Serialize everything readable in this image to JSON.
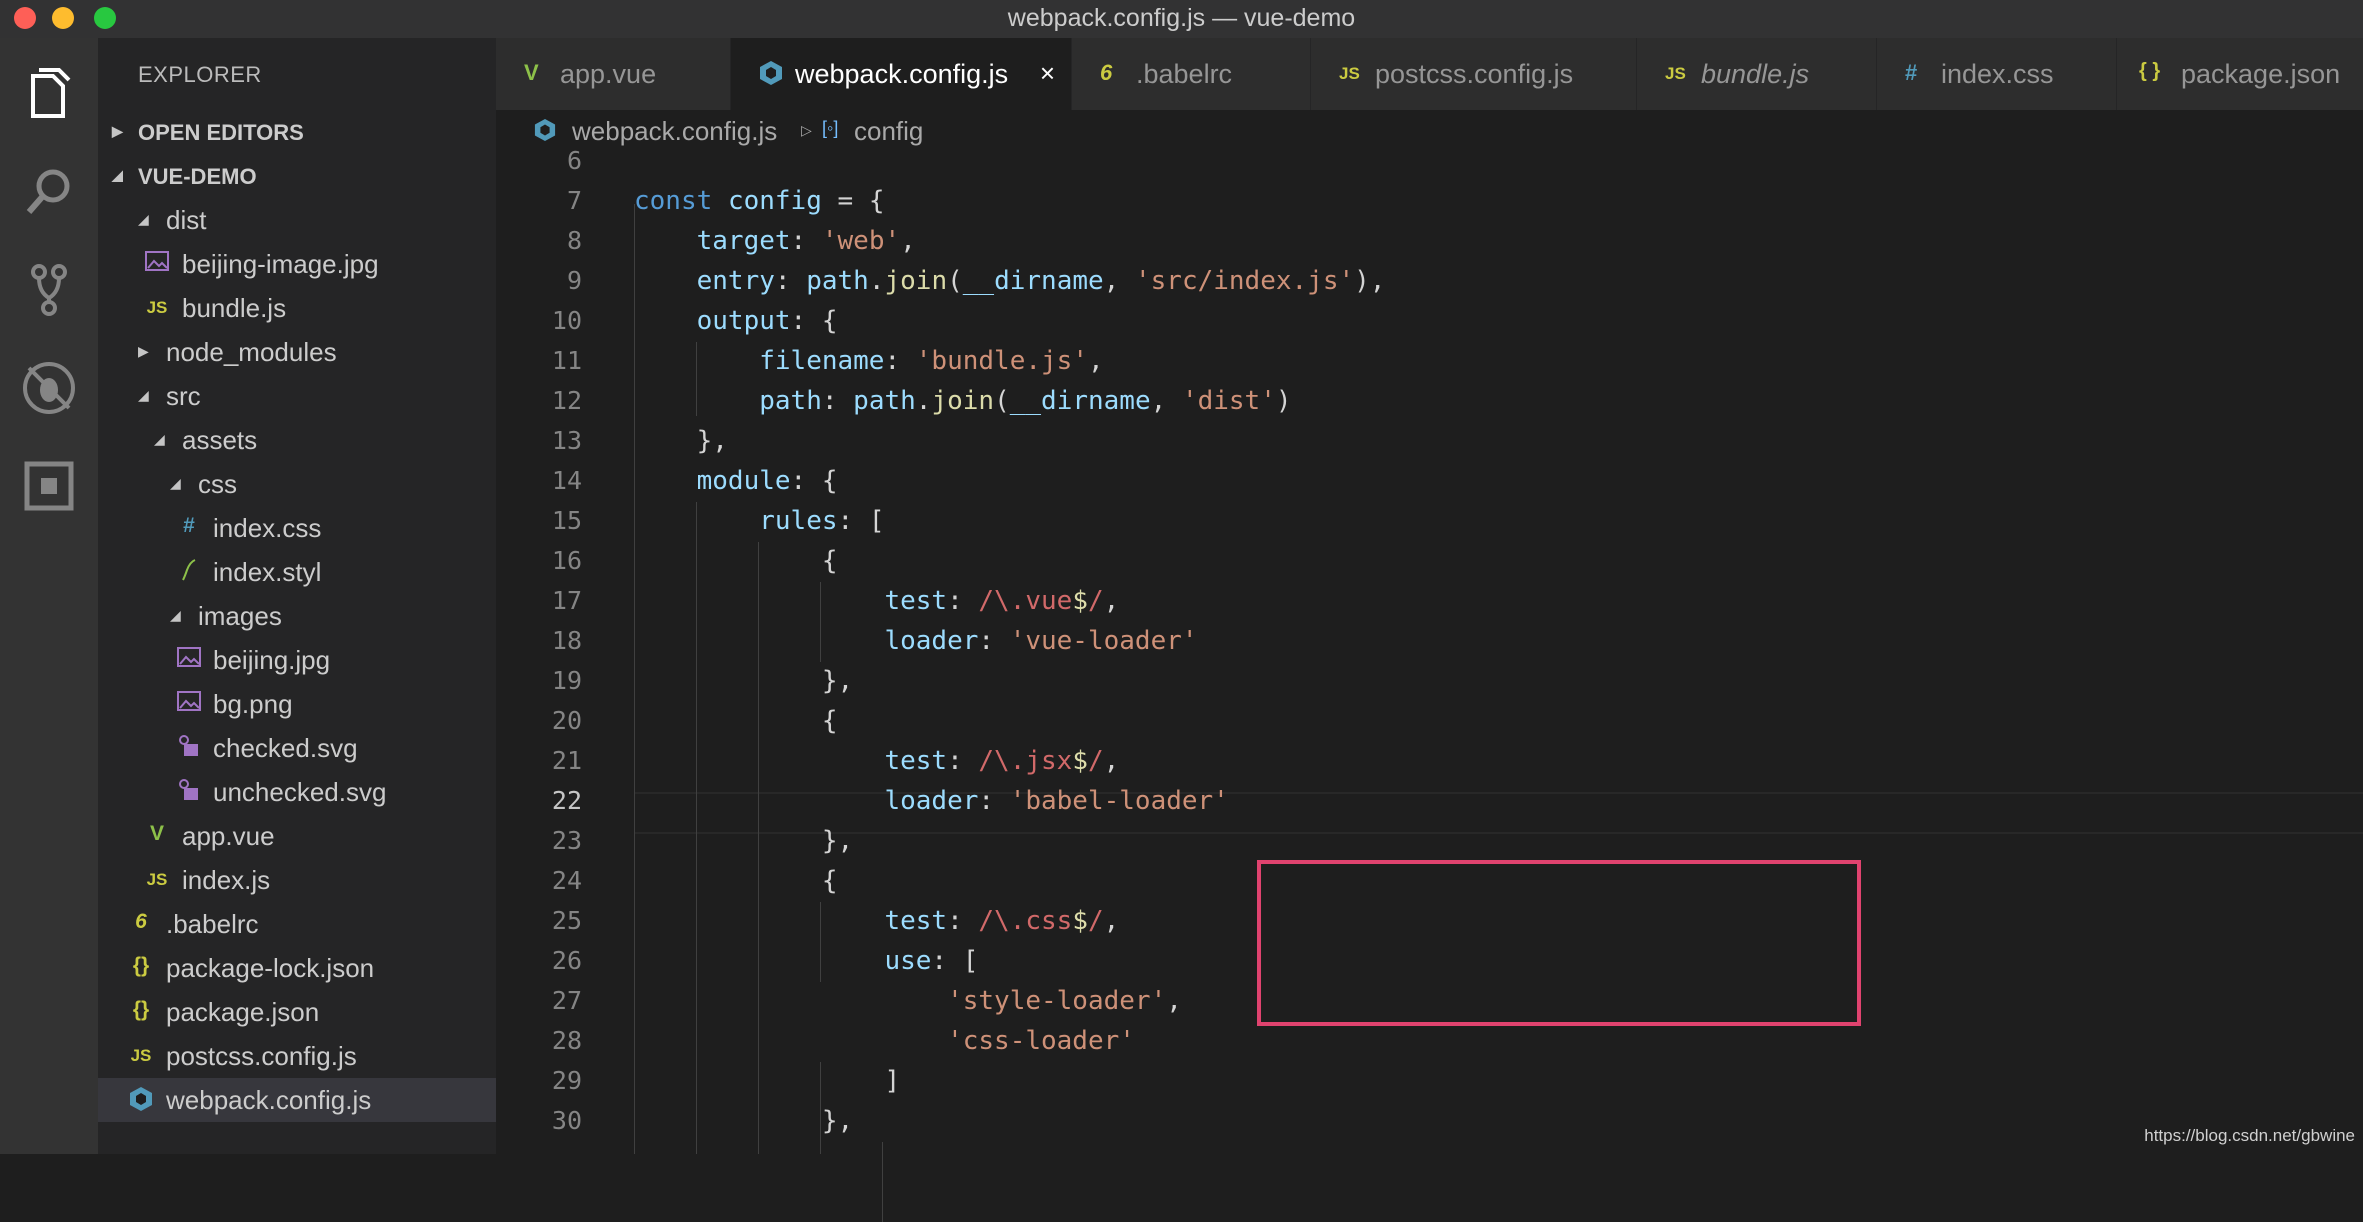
{
  "window": {
    "title": "webpack.config.js — vue-demo"
  },
  "activity_bar": {
    "icons": [
      "files-icon",
      "search-icon",
      "source-control-icon",
      "debug-icon",
      "extensions-icon"
    ]
  },
  "sidebar": {
    "title": "EXPLORER",
    "open_editors_label": "OPEN EDITORS",
    "project_label": "VUE-DEMO",
    "tree": [
      {
        "label": "dist",
        "type": "folder-open"
      },
      {
        "label": "beijing-image.jpg",
        "type": "image"
      },
      {
        "label": "bundle.js",
        "type": "js",
        "icon_text": "JS"
      },
      {
        "label": "node_modules",
        "type": "folder-closed"
      },
      {
        "label": "src",
        "type": "folder-open"
      },
      {
        "label": "assets",
        "type": "folder-open"
      },
      {
        "label": "css",
        "type": "folder-open"
      },
      {
        "label": "index.css",
        "type": "css",
        "icon_text": "#"
      },
      {
        "label": "index.styl",
        "type": "styl"
      },
      {
        "label": "images",
        "type": "folder-open"
      },
      {
        "label": "beijing.jpg",
        "type": "image"
      },
      {
        "label": "bg.png",
        "type": "image"
      },
      {
        "label": "checked.svg",
        "type": "svg"
      },
      {
        "label": "unchecked.svg",
        "type": "svg"
      },
      {
        "label": "app.vue",
        "type": "vue",
        "icon_text": "V"
      },
      {
        "label": "index.js",
        "type": "js",
        "icon_text": "JS"
      },
      {
        "label": ".babelrc",
        "type": "babel",
        "icon_text": "6"
      },
      {
        "label": "package-lock.json",
        "type": "json",
        "icon_text": "{}"
      },
      {
        "label": "package.json",
        "type": "json",
        "icon_text": "{}"
      },
      {
        "label": "postcss.config.js",
        "type": "js",
        "icon_text": "JS"
      },
      {
        "label": "webpack.config.js",
        "type": "webpack",
        "selected": true
      }
    ]
  },
  "tabs": [
    {
      "label": "app.vue",
      "icon_text": "V"
    },
    {
      "label": "webpack.config.js",
      "active": true,
      "close": "×"
    },
    {
      "label": ".babelrc",
      "icon_text": "6"
    },
    {
      "label": "postcss.config.js",
      "icon_text": "JS"
    },
    {
      "label": "bundle.js",
      "icon_text": "JS",
      "italic": true
    },
    {
      "label": "index.css",
      "icon_text": "#"
    },
    {
      "label": "package.json",
      "icon_text": "{ }"
    }
  ],
  "breadcrumb": {
    "file": "webpack.config.js",
    "symbol": "config"
  },
  "editor": {
    "line_numbers": [
      "6",
      "7",
      "8",
      "9",
      "10",
      "11",
      "12",
      "13",
      "14",
      "15",
      "16",
      "17",
      "18",
      "19",
      "20",
      "21",
      "22",
      "23",
      "24",
      "25",
      "26",
      "27",
      "28",
      "29",
      "30"
    ],
    "current_line": "22",
    "lines": [
      [],
      [
        [
          "kw",
          "const"
        ],
        [
          "pl",
          " "
        ],
        [
          "vr",
          "config"
        ],
        [
          "pl",
          " = {"
        ]
      ],
      [
        [
          "pl",
          "    "
        ],
        [
          "prop",
          "target"
        ],
        [
          "pl",
          ": "
        ],
        [
          "str",
          "'web'"
        ],
        [
          "pl",
          ","
        ]
      ],
      [
        [
          "pl",
          "    "
        ],
        [
          "prop",
          "entry"
        ],
        [
          "pl",
          ": "
        ],
        [
          "vr",
          "path"
        ],
        [
          "pl",
          "."
        ],
        [
          "fn",
          "join"
        ],
        [
          "pl",
          "("
        ],
        [
          "vr",
          "__dirname"
        ],
        [
          "pl",
          ", "
        ],
        [
          "str",
          "'src/index.js'"
        ],
        [
          "pl",
          "),"
        ]
      ],
      [
        [
          "pl",
          "    "
        ],
        [
          "prop",
          "output"
        ],
        [
          "pl",
          ": {"
        ]
      ],
      [
        [
          "pl",
          "        "
        ],
        [
          "prop",
          "filename"
        ],
        [
          "pl",
          ": "
        ],
        [
          "str",
          "'bundle.js'"
        ],
        [
          "pl",
          ","
        ]
      ],
      [
        [
          "pl",
          "        "
        ],
        [
          "prop",
          "path"
        ],
        [
          "pl",
          ": "
        ],
        [
          "vr",
          "path"
        ],
        [
          "pl",
          "."
        ],
        [
          "fn",
          "join"
        ],
        [
          "pl",
          "("
        ],
        [
          "vr",
          "__dirname"
        ],
        [
          "pl",
          ", "
        ],
        [
          "str",
          "'dist'"
        ],
        [
          "pl",
          ")"
        ]
      ],
      [
        [
          "pl",
          "    },"
        ]
      ],
      [
        [
          "pl",
          "    "
        ],
        [
          "prop",
          "module"
        ],
        [
          "pl",
          ": {"
        ]
      ],
      [
        [
          "pl",
          "        "
        ],
        [
          "prop",
          "rules"
        ],
        [
          "pl",
          ": ["
        ]
      ],
      [
        [
          "pl",
          "            {"
        ]
      ],
      [
        [
          "pl",
          "                "
        ],
        [
          "prop",
          "test"
        ],
        [
          "pl",
          ": "
        ],
        [
          "re",
          "/\\."
        ],
        [
          "re",
          "vue"
        ],
        [
          "dollar",
          "$"
        ],
        [
          "re",
          "/"
        ],
        [
          "pl",
          ","
        ]
      ],
      [
        [
          "pl",
          "                "
        ],
        [
          "prop",
          "loader"
        ],
        [
          "pl",
          ": "
        ],
        [
          "str",
          "'vue-loader'"
        ]
      ],
      [
        [
          "pl",
          "            },"
        ]
      ],
      [
        [
          "pl",
          "            {"
        ]
      ],
      [
        [
          "pl",
          "                "
        ],
        [
          "prop",
          "test"
        ],
        [
          "pl",
          ": "
        ],
        [
          "re",
          "/\\."
        ],
        [
          "re",
          "jsx"
        ],
        [
          "dollar",
          "$"
        ],
        [
          "re",
          "/"
        ],
        [
          "pl",
          ","
        ]
      ],
      [
        [
          "pl",
          "                "
        ],
        [
          "prop",
          "loader"
        ],
        [
          "pl",
          ": "
        ],
        [
          "str",
          "'babel-loader'"
        ]
      ],
      [
        [
          "pl",
          "            },"
        ]
      ],
      [
        [
          "pl",
          "            {"
        ]
      ],
      [
        [
          "pl",
          "                "
        ],
        [
          "prop",
          "test"
        ],
        [
          "pl",
          ": "
        ],
        [
          "re",
          "/\\."
        ],
        [
          "re",
          "css"
        ],
        [
          "dollar",
          "$"
        ],
        [
          "re",
          "/"
        ],
        [
          "pl",
          ","
        ]
      ],
      [
        [
          "pl",
          "                "
        ],
        [
          "prop",
          "use"
        ],
        [
          "pl",
          ": ["
        ]
      ],
      [
        [
          "pl",
          "                    "
        ],
        [
          "str",
          "'style-loader'"
        ],
        [
          "pl",
          ","
        ]
      ],
      [
        [
          "pl",
          "                    "
        ],
        [
          "str",
          "'css-loader'"
        ]
      ],
      [
        [
          "pl",
          "                ]"
        ]
      ],
      [
        [
          "pl",
          "            },"
        ]
      ]
    ]
  },
  "watermark": "https://blog.csdn.net/gbwine",
  "colors": {
    "highlight_box": "#e0436f",
    "vue": "#8dc149",
    "js": "#cbcb41",
    "css": "#519aba",
    "svg": "#a074c4",
    "webpack": "#519aba"
  }
}
